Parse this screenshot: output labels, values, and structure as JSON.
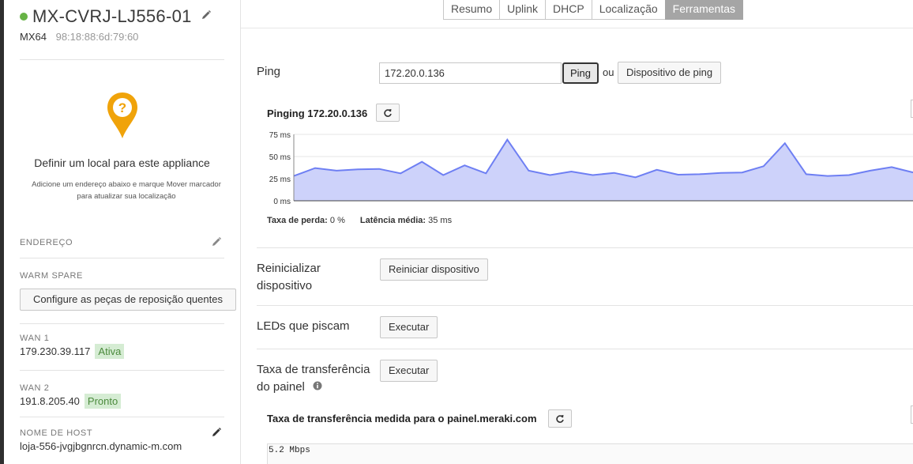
{
  "device": {
    "name": "MX-CVRJ-LJ556-01",
    "model": "MX64",
    "mac": "98:18:88:6d:79:60",
    "status_color": "#67b346"
  },
  "location": {
    "title": "Definir um local para este appliance",
    "help": "Adicione um endereço abaixo e marque Mover marcador para atualizar sua localização",
    "pin_color": "#f0a30a"
  },
  "sidebar": {
    "address_label": "ENDEREÇO",
    "warm_spare_label": "WARM SPARE",
    "warm_spare_button": "Configure as peças de reposição quentes",
    "wan1": {
      "label": "WAN 1",
      "ip": "179.230.39.117",
      "status": "Ativa"
    },
    "wan2": {
      "label": "WAN 2",
      "ip": "191.8.205.40",
      "status": "Pronto"
    },
    "hostname_label": "NOME DE HOST",
    "hostname": "loja-556-jvgjbgnrcn.dynamic-m.com"
  },
  "tabs": [
    {
      "label": "Resumo",
      "active": false
    },
    {
      "label": "Uplink",
      "active": false
    },
    {
      "label": "DHCP",
      "active": false
    },
    {
      "label": "Localização",
      "active": false
    },
    {
      "label": "Ferramentas",
      "active": true
    }
  ],
  "tools": {
    "ping_label": "Ping",
    "ping_input_value": "172.20.0.136",
    "ping_button": "Ping",
    "or_text": "ou",
    "ping_device_button": "Dispositivo de ping",
    "ping_chart_title": "Pinging 172.20.0.136",
    "loss_label": "Taxa de perda:",
    "loss_value": "0 %",
    "latency_label": "Latência média:",
    "latency_value": "35 ms",
    "reboot_label": "Reinicializar dispositivo",
    "reboot_button": "Reiniciar dispositivo",
    "leds_label": "LEDs que piscam",
    "leds_button": "Executar",
    "throughput_label": "Taxa de transferência do painel",
    "throughput_button": "Executar",
    "throughput_title": "Taxa de transferência medida para o painel.meraki.com",
    "throughput_value": "5.2 Mbps"
  },
  "chart_data": {
    "type": "area",
    "title": "Pinging 172.20.0.136",
    "ylim": [
      0,
      75
    ],
    "y_ticks": [
      "75 ms",
      "50 ms",
      "25 ms",
      "0 ms"
    ],
    "values": [
      28,
      37,
      34,
      35.5,
      36,
      31,
      44,
      29,
      40,
      31,
      69,
      34,
      29,
      33,
      29,
      31.5,
      26.5,
      35,
      29.5,
      30,
      31.5,
      32,
      39,
      65,
      30,
      28,
      29,
      34,
      38,
      32
    ],
    "series_color": "#6e7ff3",
    "fill_color": "#cdd2fa",
    "grid": true
  }
}
